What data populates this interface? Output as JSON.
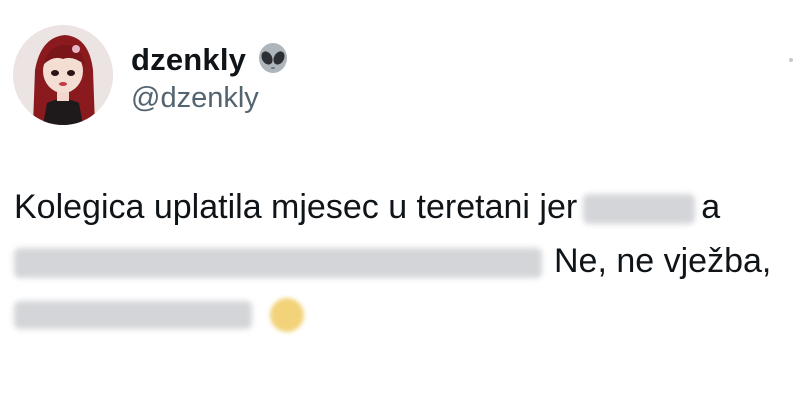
{
  "tweet": {
    "display_name": "dzenkly",
    "handle": "@dzenkly",
    "name_emoji_icon": "alien-emoji-icon",
    "more_icon": "dot-icon",
    "body": {
      "line1_text": "Kolegica uplatila mjesec u teretani jer",
      "line1_end": "a",
      "line2_text": "Ne, ne vježba,",
      "redacted_color": "#d3d5d8",
      "emoji_color": "#f2d37a"
    }
  }
}
